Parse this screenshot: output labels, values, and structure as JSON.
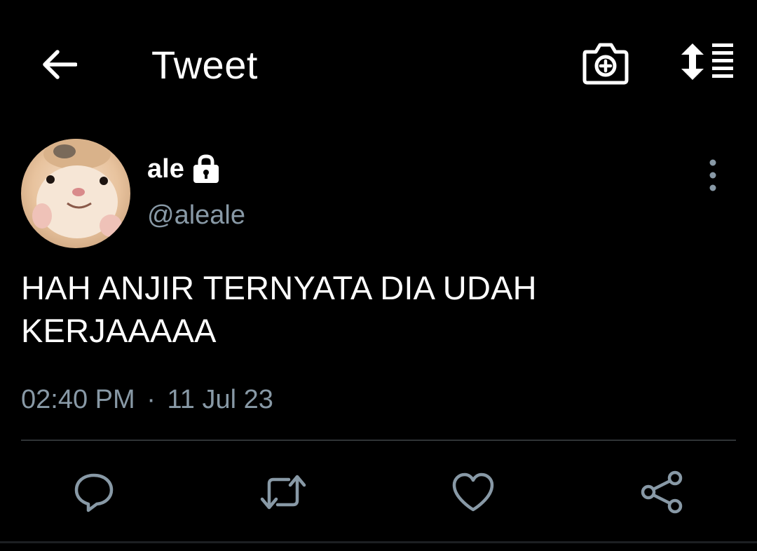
{
  "header": {
    "title": "Tweet",
    "back_icon": "arrow-left-icon",
    "camera_icon": "camera-plus-icon",
    "sort_icon": "sort-list-icon"
  },
  "tweet": {
    "author": {
      "display_name": "ale",
      "handle": "@aleale",
      "protected_icon": "lock-icon",
      "avatar": "hamster-avatar"
    },
    "text_lines": [
      "HAH ANJIR TERNYATA DIA UDAH",
      "KERJAAAAA"
    ],
    "time": "02:40 PM",
    "separator": "·",
    "date": "11 Jul 23"
  },
  "actions": [
    {
      "name": "reply",
      "icon": "reply-bubble-icon"
    },
    {
      "name": "retweet",
      "icon": "retweet-icon"
    },
    {
      "name": "like",
      "icon": "heart-icon"
    },
    {
      "name": "share",
      "icon": "share-icon"
    }
  ],
  "colors": {
    "background": "#000000",
    "text": "#ffffff",
    "secondary": "#8899a6",
    "divider": "#2f3336"
  }
}
